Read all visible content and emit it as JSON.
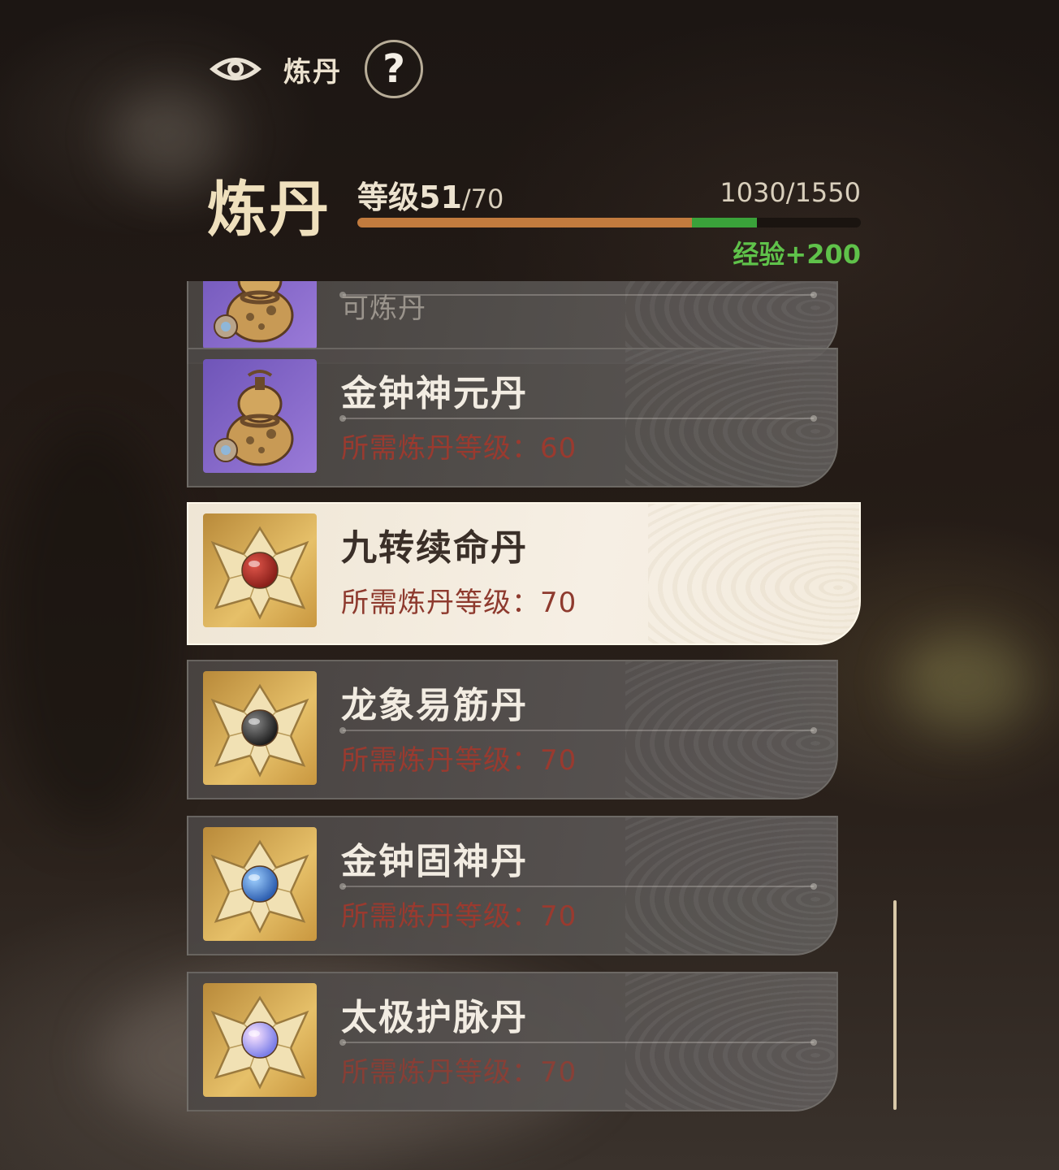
{
  "topbar": {
    "title": "炼丹",
    "help": "?"
  },
  "header": {
    "title": "炼丹",
    "level_label": "等级51",
    "level_max": "/70",
    "exp_text": "1030/1550",
    "exp_gain": "经验+200",
    "progress_current": 0.665,
    "progress_gain": 0.129
  },
  "colors": {
    "progress": "#c27b3e",
    "gain": "#3aa23a",
    "requirement": "#9a3a2f"
  },
  "recipes": [
    {
      "name": "",
      "requirement": "可炼丹",
      "icon": "gourd-icon",
      "selected": false
    },
    {
      "name": "金钟神元丹",
      "requirement": "所需炼丹等级：60",
      "icon": "gourd-icon",
      "selected": false
    },
    {
      "name": "九转续命丹",
      "requirement": "所需炼丹等级：70",
      "icon": "red-pill-icon",
      "selected": true
    },
    {
      "name": "龙象易筋丹",
      "requirement": "所需炼丹等级：70",
      "icon": "black-pill-icon",
      "selected": false
    },
    {
      "name": "金钟固神丹",
      "requirement": "所需炼丹等级：70",
      "icon": "blue-pill-icon",
      "selected": false
    },
    {
      "name": "太极护脉丹",
      "requirement": "所需炼丹等级：70",
      "icon": "iridescent-pill-icon",
      "selected": false
    }
  ]
}
